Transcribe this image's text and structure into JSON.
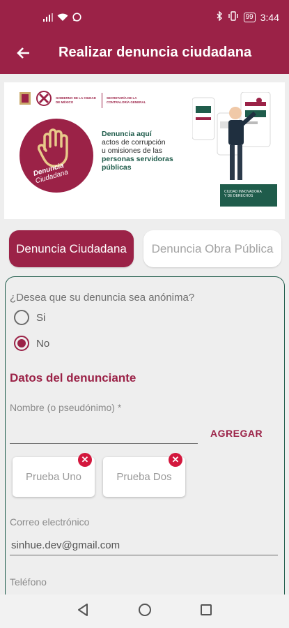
{
  "status_bar": {
    "time": "3:44",
    "battery": "99",
    "icons": [
      "signal-icon",
      "wifi-icon",
      "whatsapp-icon",
      "bluetooth-icon",
      "vibrate-icon"
    ]
  },
  "app_bar": {
    "title": "Realizar denuncia ciudadana",
    "back_icon": "arrow-left-icon"
  },
  "banner": {
    "gov_text_1": "GOBIERNO DE LA CIUDAD DE MÉXICO",
    "gov_text_2": "SECRETARÍA DE LA CONTRALORÍA GENERAL",
    "logo_text_1": "Denuncia",
    "logo_text_2": "Ciudadana",
    "headline_bold": "Denuncia aquí",
    "headline_line_2": "actos de corrupción",
    "headline_line_3": "u omisiones de las",
    "headline_bold_2": "personas servidoras públicas",
    "tagline_1": "CIUDAD INNOVADORA",
    "tagline_2": "Y DE DERECHOS"
  },
  "tabs": [
    {
      "label": "Denuncia Ciudadana",
      "active": true
    },
    {
      "label": "Denuncia Obra Pública",
      "active": false
    }
  ],
  "form": {
    "anonymous_question": "¿Desea que su denuncia sea anónima?",
    "options": [
      {
        "label": "Si",
        "selected": false
      },
      {
        "label": "No",
        "selected": true
      }
    ],
    "section_title": "Datos del denunciante",
    "name_label": "Nombre (o pseudónimo) *",
    "add_button": "AGREGAR",
    "chips": [
      {
        "label": "Prueba Uno"
      },
      {
        "label": "Prueba Dos"
      }
    ],
    "email_label": "Correo electrónico",
    "email_value": "sinhue.dev@gmail.com",
    "phone_label": "Teléfono"
  },
  "colors": {
    "primary": "#9b2247",
    "secondary": "#1f5c4b",
    "chip_close": "#d3173d",
    "background": "#eeeeee"
  }
}
